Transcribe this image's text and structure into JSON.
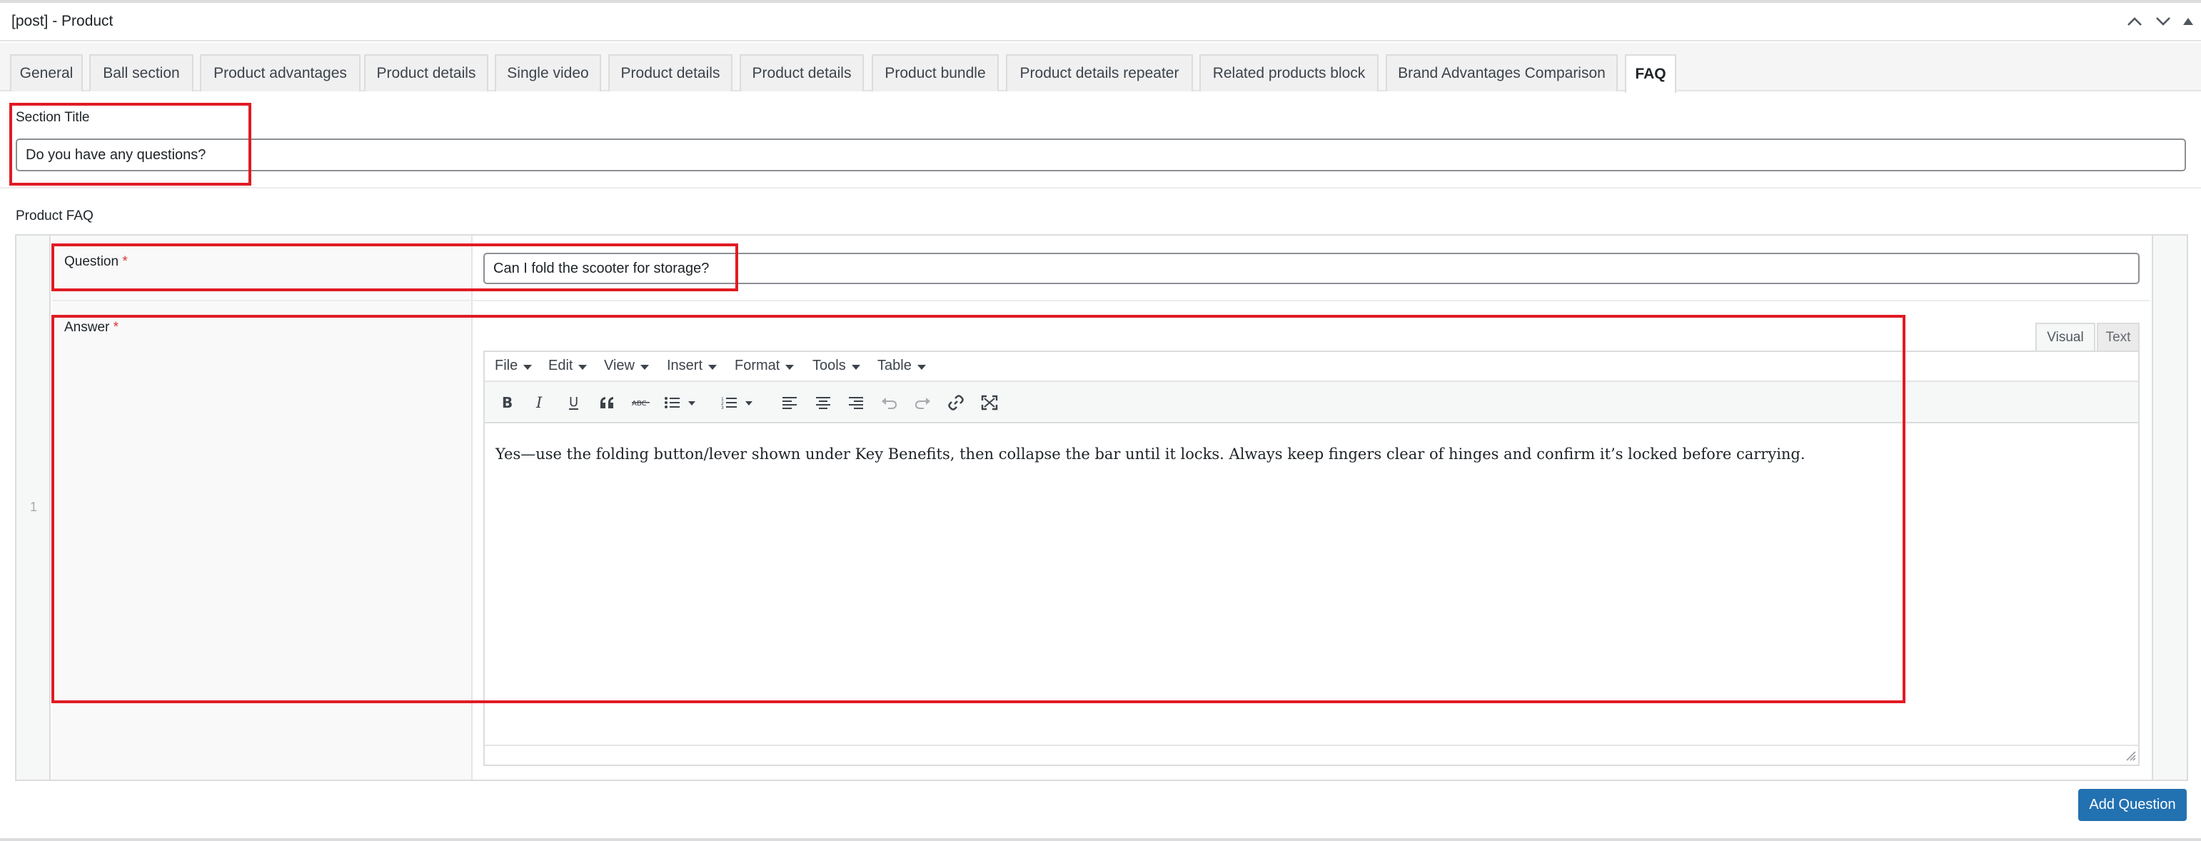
{
  "metabox": {
    "title": "[post] - Product"
  },
  "tabs": [
    {
      "label": "General"
    },
    {
      "label": "Ball section"
    },
    {
      "label": "Product advantages"
    },
    {
      "label": "Product details"
    },
    {
      "label": "Single video"
    },
    {
      "label": "Product details"
    },
    {
      "label": "Product details"
    },
    {
      "label": "Product bundle"
    },
    {
      "label": "Product details repeater"
    },
    {
      "label": "Related products block"
    },
    {
      "label": "Brand Advantages Comparison"
    },
    {
      "label": "FAQ",
      "active": true
    }
  ],
  "section_title": {
    "label": "Section Title",
    "value": "Do you have any questions?"
  },
  "faq": {
    "label": "Product FAQ",
    "row_number": "1",
    "question_label": "Question",
    "question_value": "Can I fold the scooter for storage?",
    "answer_label": "Answer",
    "required_mark": "*",
    "editor": {
      "tab_visual": "Visual",
      "tab_text": "Text",
      "menus": [
        "File",
        "Edit",
        "View",
        "Insert",
        "Format",
        "Tools",
        "Table"
      ],
      "toolbar_icons": [
        "bold-icon",
        "italic-icon",
        "underline-icon",
        "blockquote-icon",
        "strikethrough-icon",
        "bullet-list-icon",
        "numbered-list-icon",
        "align-left-icon",
        "align-center-icon",
        "align-right-icon",
        "undo-icon",
        "redo-icon",
        "link-icon",
        "fullscreen-icon"
      ],
      "content": "Yes—use the folding button/lever shown under Key Benefits, then collapse the bar until it locks. Always keep fingers clear of hinges and confirm it’s locked before carrying."
    },
    "add_button": "Add Question"
  },
  "colors": {
    "primary_button": "#2271b1",
    "highlight_box": "#e01b24",
    "required": "#d63638"
  }
}
